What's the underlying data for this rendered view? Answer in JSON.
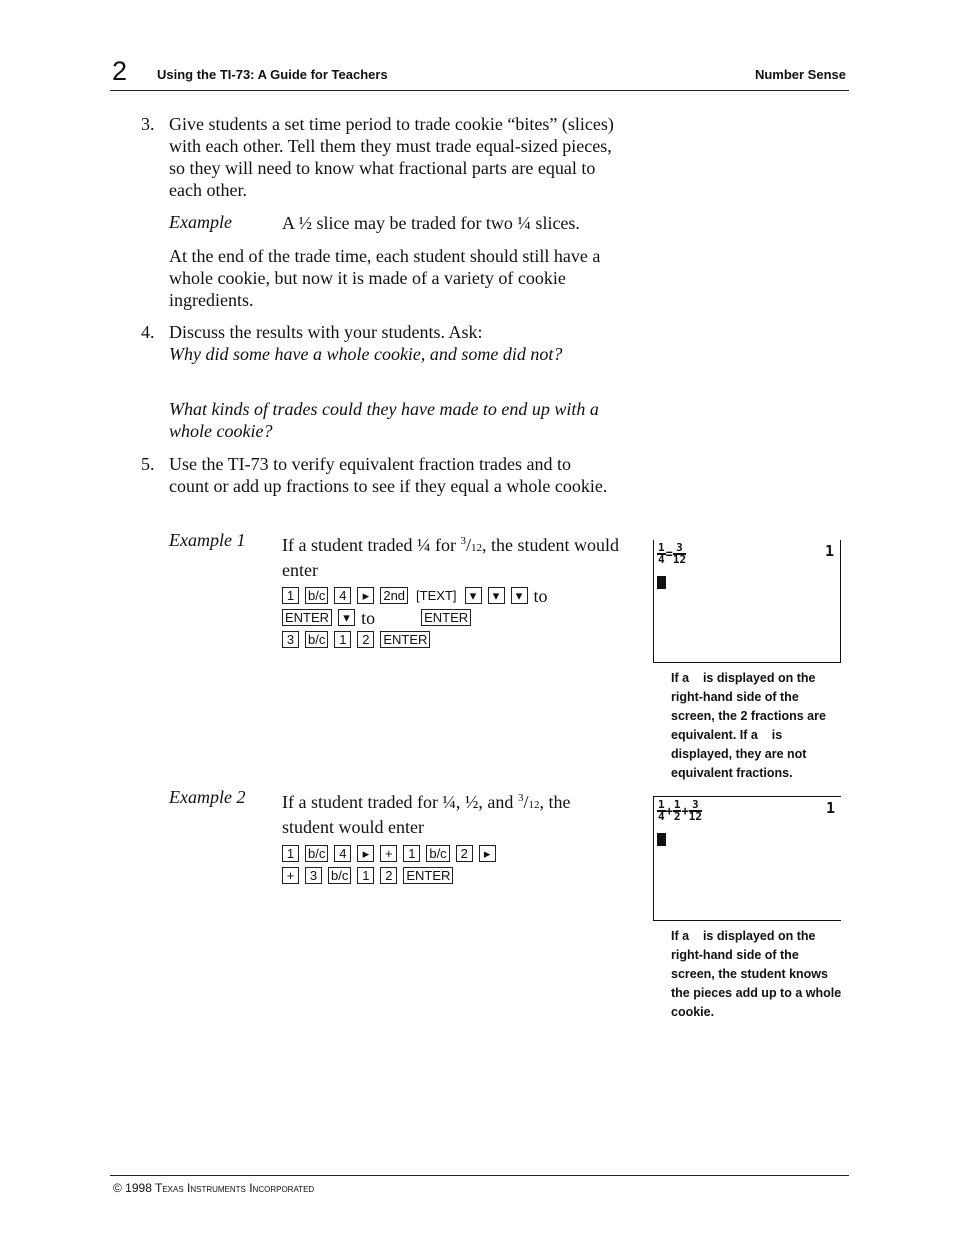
{
  "header": {
    "page_number": "2",
    "title": "Using the TI-73: A Guide for Teachers",
    "section": "Number Sense"
  },
  "steps": [
    {
      "number": "3.",
      "text": "Give students a set time period to trade cookie “bites” (slices) with each other. Tell them they must trade equal-sized pieces, so they will need to know what fractional parts are equal to each other.",
      "example_label": "Example",
      "example_text": "A ½ slice may be traded for two ¼ slices.",
      "followup": "At the end of the trade time, each student should still have a whole cookie, but now it is made of a variety of cookie ingredients."
    },
    {
      "number": "4.",
      "text": "Discuss the results with your students. Ask:",
      "question_1": "Why did some have a whole cookie, and some did not?",
      "question_2": "What kinds of trades could they have made to end up with a whole cookie?"
    },
    {
      "number": "5.",
      "text": "Use the TI-73 to verify equivalent fraction trades and to count or add up fractions to see if they equal a whole cookie."
    }
  ],
  "example1": {
    "label": "Example 1",
    "text_a": "If a student traded ¼ for ",
    "frac_num": "3",
    "frac_den": "12",
    "text_b": ", the student would enter",
    "keys_line1": [
      "1",
      "b/c",
      "4",
      "▸",
      "2nd",
      "[TEXT]",
      "▾",
      "▾",
      "▾"
    ],
    "word_to": "to",
    "keys_line2a": [
      "ENTER",
      "▾"
    ],
    "keys_line2b": [
      "ENTER"
    ],
    "keys_line3": [
      "3",
      "b/c",
      "1",
      "2",
      "ENTER"
    ],
    "screen": {
      "fractions": [
        [
          "1",
          "4"
        ],
        [
          "3",
          "12"
        ]
      ],
      "operator": "=",
      "result": "1"
    },
    "caption": "If a    is displayed on the right-hand side of the screen, the 2 fractions are equivalent. If a    is displayed, they are not equivalent fractions."
  },
  "example2": {
    "label": "Example 2",
    "text_a": "If a student traded for ¼, ½, and ",
    "frac_num": "3",
    "frac_den": "12",
    "text_b": ", the student would enter",
    "keys_line1": [
      "1",
      "b/c",
      "4",
      "▸",
      "+",
      "1",
      "b/c",
      "2",
      "▸"
    ],
    "keys_line2": [
      "+",
      "3",
      "b/c",
      "1",
      "2",
      "ENTER"
    ],
    "screen": {
      "fractions": [
        [
          "1",
          "4"
        ],
        [
          "1",
          "2"
        ],
        [
          "3",
          "12"
        ]
      ],
      "operator": "+",
      "result": "1"
    },
    "caption": "If a    is displayed on the right-hand side of the screen, the student knows the pieces add up to a whole cookie."
  },
  "footer": {
    "copyright": "© 1998 Texas Instruments Incorporated"
  }
}
